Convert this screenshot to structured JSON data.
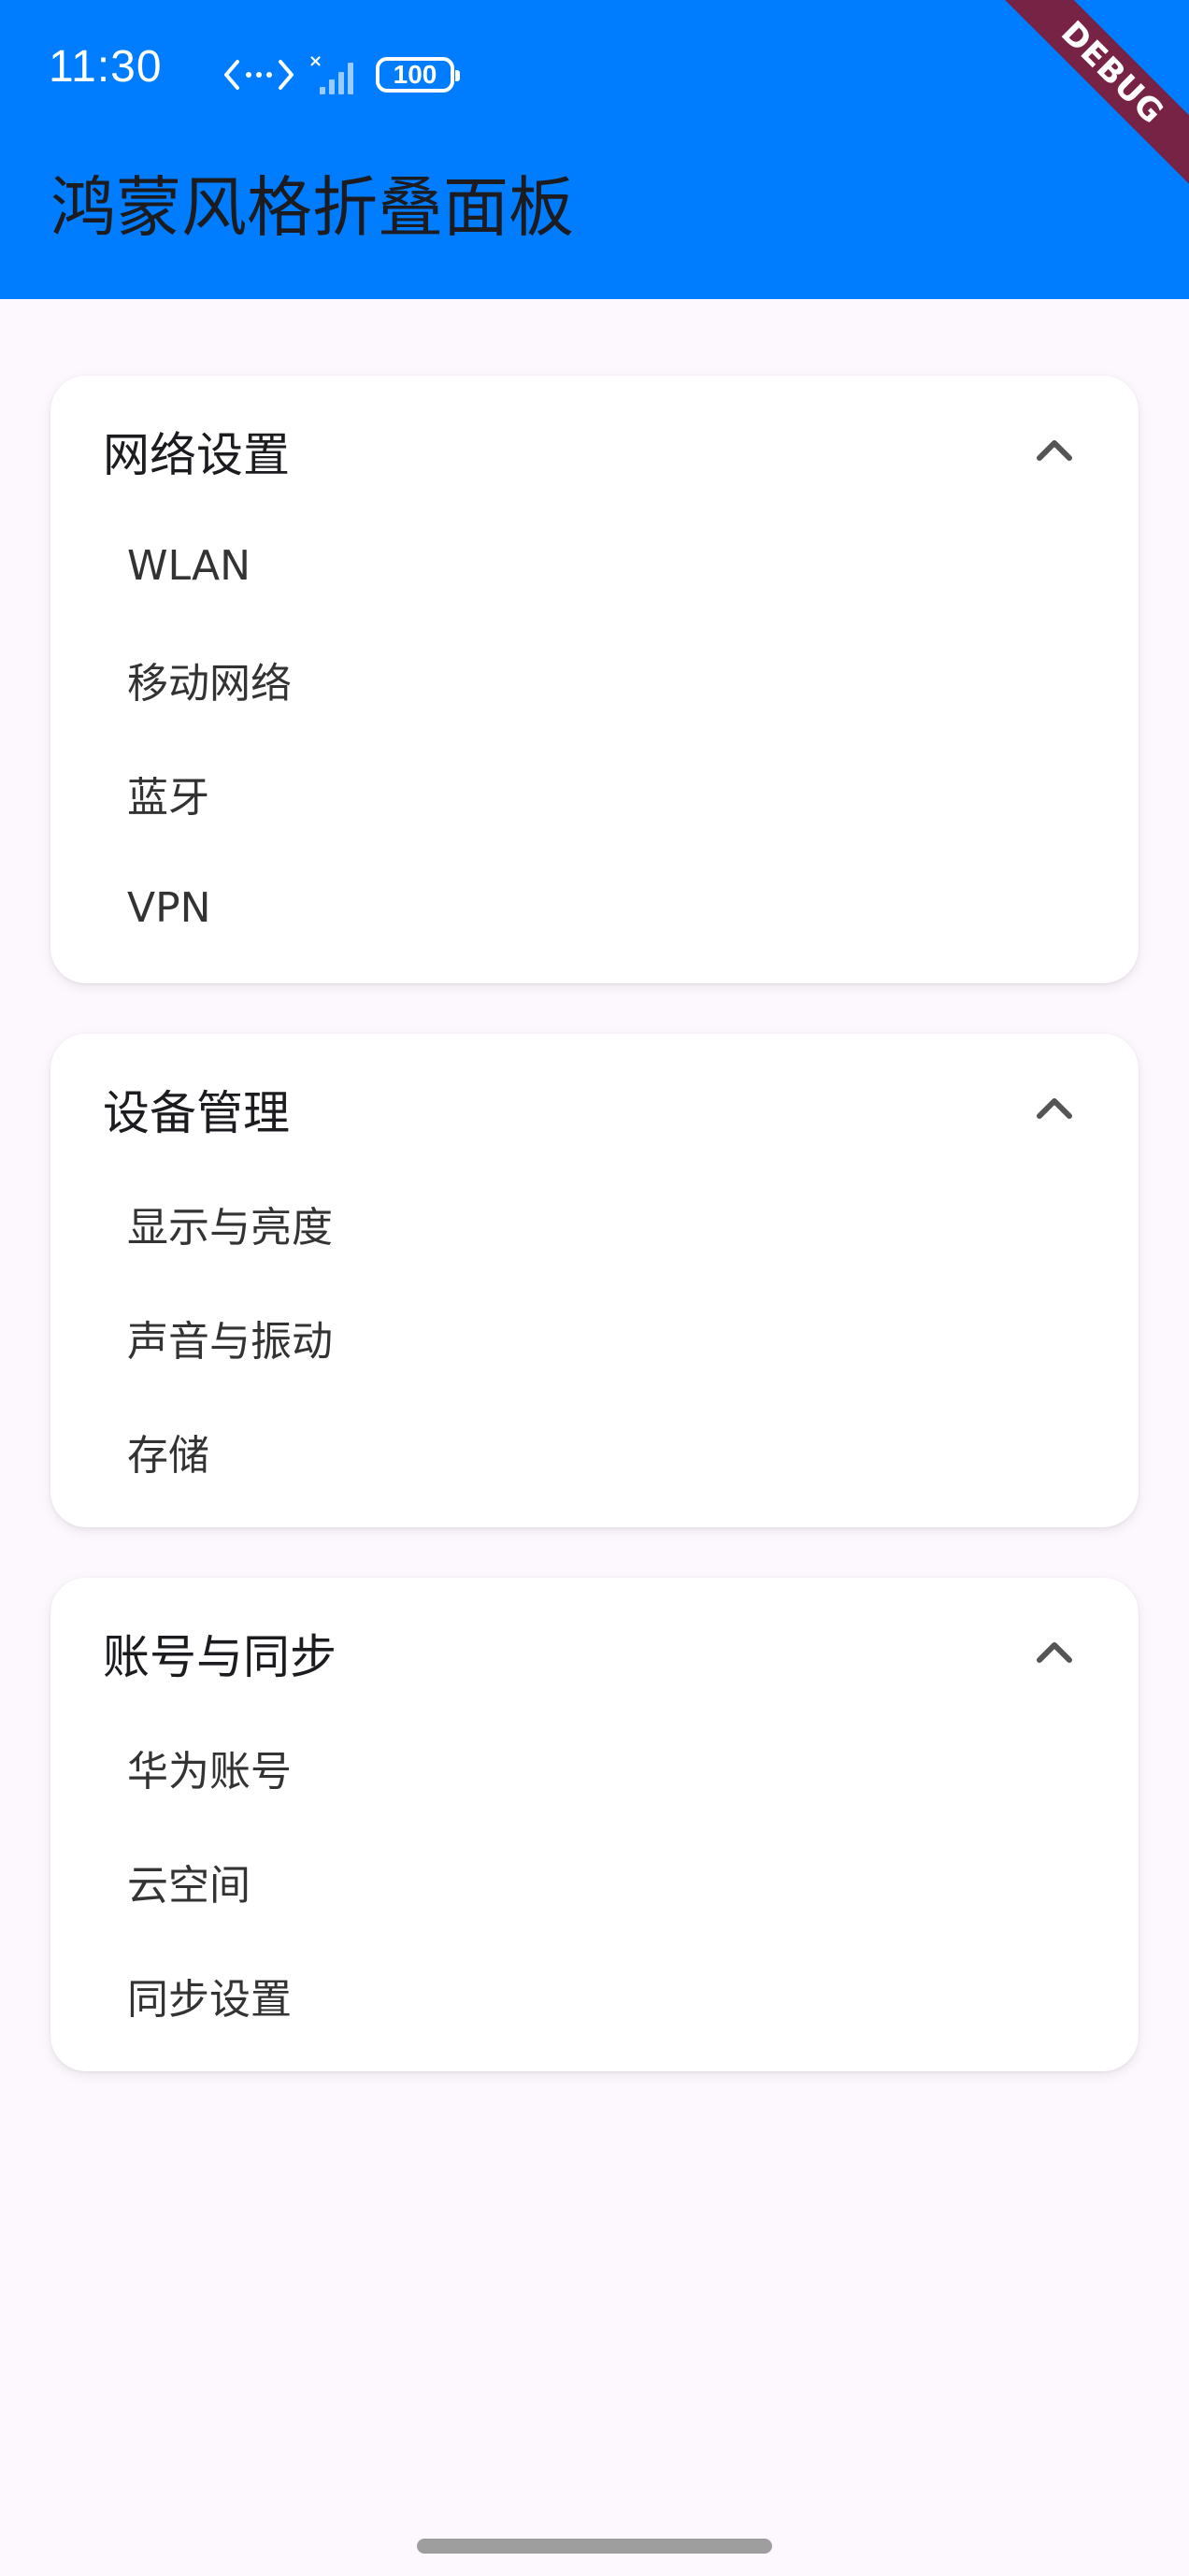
{
  "status_bar": {
    "time": "11:30",
    "battery": "100",
    "icons": [
      "data-transfer-icon",
      "signal-no-sim-icon",
      "battery-icon"
    ]
  },
  "app_bar": {
    "title": "鸿蒙风格折叠面板",
    "color": "#007DFF"
  },
  "debug_banner": "DEBUG",
  "panels": [
    {
      "title": "网络设置",
      "expanded": true,
      "items": [
        "WLAN",
        "移动网络",
        "蓝牙",
        "VPN"
      ]
    },
    {
      "title": "设备管理",
      "expanded": true,
      "items": [
        "显示与亮度",
        "声音与振动",
        "存储"
      ]
    },
    {
      "title": "账号与同步",
      "expanded": true,
      "items": [
        "华为账号",
        "云空间",
        "同步设置"
      ]
    }
  ]
}
